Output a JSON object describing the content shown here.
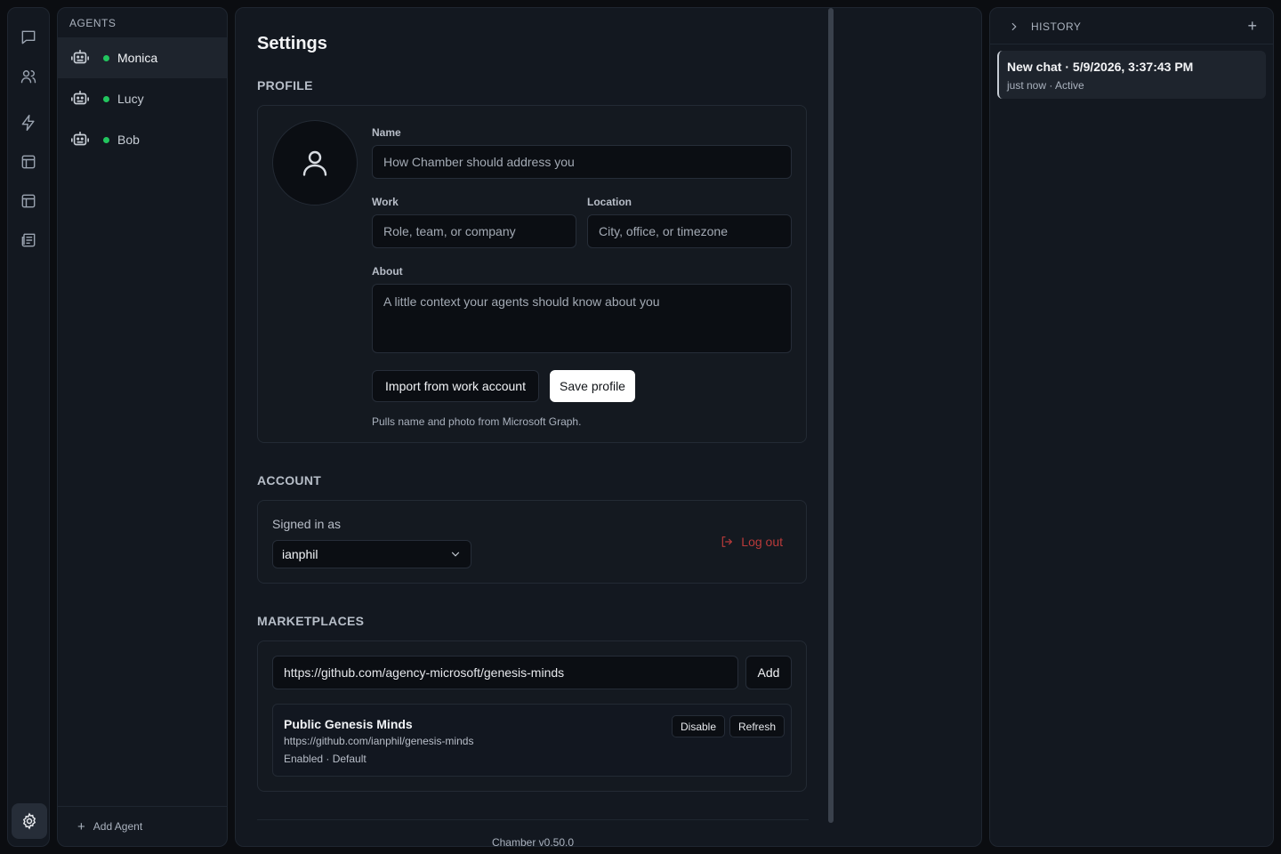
{
  "rail": {
    "icons": [
      "chat-icon",
      "users-icon",
      "lightning-icon",
      "layout-icon",
      "layout-alt-icon",
      "newspaper-icon",
      "gear-icon"
    ]
  },
  "agents": {
    "heading": "AGENTS",
    "items": [
      {
        "label": "Monica",
        "status_color": "#22c55e"
      },
      {
        "label": "Lucy",
        "status_color": "#22c55e"
      },
      {
        "label": "Bob",
        "status_color": "#22c55e"
      }
    ],
    "add_label": "Add Agent"
  },
  "settings": {
    "title": "Settings",
    "profile": {
      "heading": "PROFILE",
      "name_label": "Name",
      "name_placeholder": "How Chamber should address you",
      "work_label": "Work",
      "work_placeholder": "Role, team, or company",
      "location_label": "Location",
      "location_placeholder": "City, office, or timezone",
      "about_label": "About",
      "about_placeholder": "A little context your agents should know about you",
      "import_button": "Import from work account",
      "save_button": "Save profile",
      "hint": "Pulls name and photo from Microsoft Graph."
    },
    "account": {
      "heading": "ACCOUNT",
      "signed_in_label": "Signed in as",
      "selected_account": "ianphil",
      "logout_label": "Log out"
    },
    "marketplaces": {
      "heading": "MARKETPLACES",
      "url_value": "https://github.com/agency-microsoft/genesis-minds",
      "add_button": "Add",
      "entry": {
        "name": "Public Genesis Minds",
        "url": "https://github.com/ianphil/genesis-minds",
        "status": "Enabled · Default",
        "disable_button": "Disable",
        "refresh_button": "Refresh"
      }
    },
    "version": "Chamber v0.50.0"
  },
  "history": {
    "heading": "HISTORY",
    "items": [
      {
        "title": "New chat · 5/9/2026, 3:37:43 PM",
        "meta": "just now · Active"
      }
    ]
  },
  "colors": {
    "status_online": "#22c55e",
    "danger": "#b93a3a",
    "panel_bg": "#131820",
    "app_bg": "#0b0d11"
  }
}
